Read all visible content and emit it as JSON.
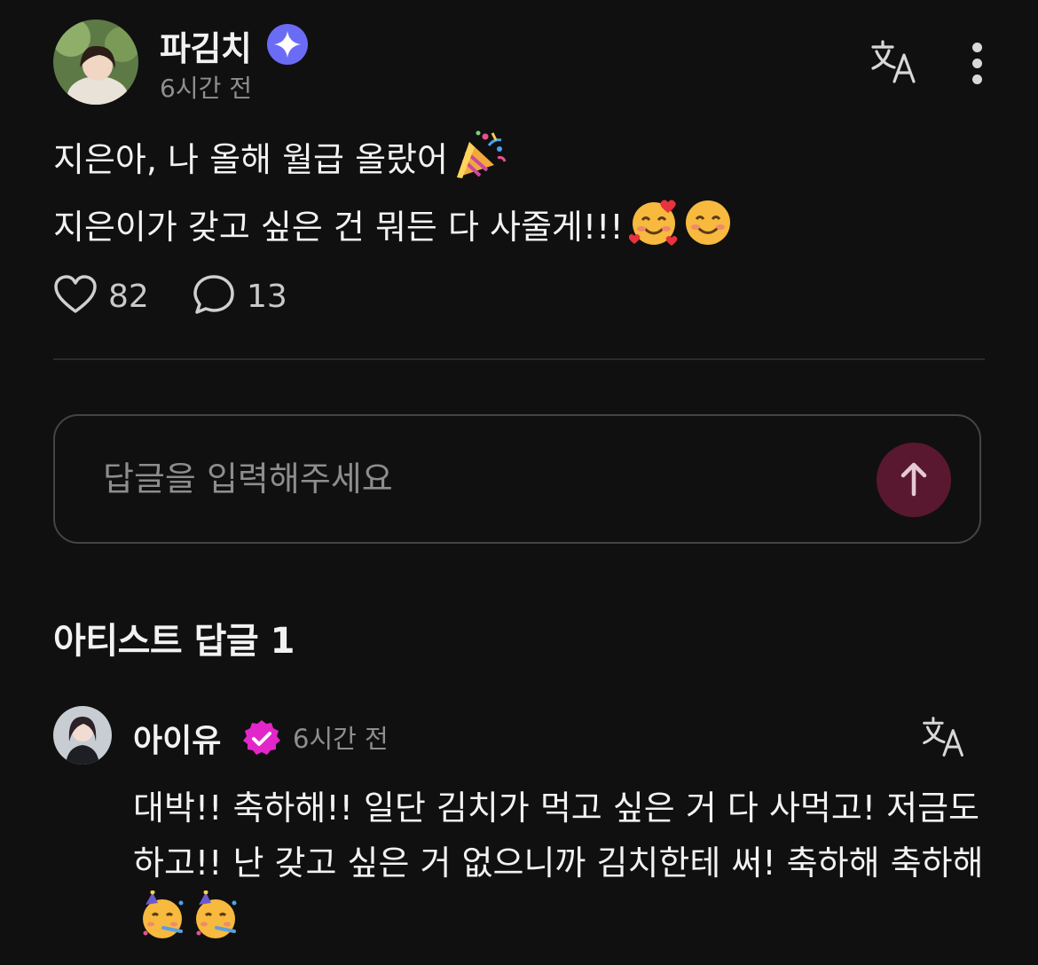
{
  "post": {
    "author": "파김치",
    "time": "6시간 전",
    "line1": "지은아, 나 올해 월급 올랐어",
    "line2": "지은이가 갖고 싶은 건 뭐든 다 사줄게!!!",
    "likes": "82",
    "comments": "13"
  },
  "reply_input": {
    "placeholder": "답글을 입력해주세요"
  },
  "artist_section": {
    "title": "아티스트 답글 1"
  },
  "artist_reply": {
    "author": "아이유",
    "time": "6시간 전",
    "text": "대박!! 축하해!! 일단 김치가 먹고 싶은 거 다 사먹고! 저금도 하고!! 난 갖고 싶은 거 없으니까 김치한테 써! 축하해 축하해"
  },
  "icons": {
    "verified_post": "blue-sparkle-badge-icon",
    "verified_artist": "pink-check-badge-icon",
    "translate": "translate-icon",
    "more": "more-vertical-icon",
    "like": "heart-icon",
    "comment": "comment-bubble-icon",
    "send": "arrow-up-icon"
  },
  "colors": {
    "background": "#101010",
    "text": "#f2f2f2",
    "muted": "#8e8e8e",
    "verified_blue": "#6b6cf5",
    "verified_pink": "#e326c9",
    "send_button": "#5a1830"
  }
}
